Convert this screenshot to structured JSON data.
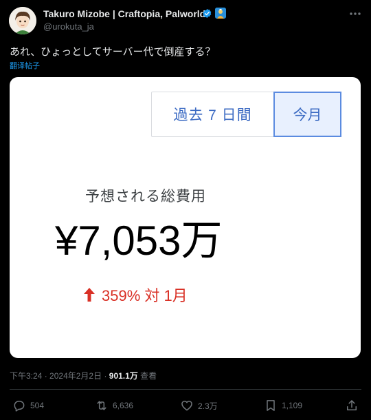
{
  "author": {
    "name": "Takuro Mizobe | Craftopia, Palworld",
    "handle": "@urokuta_ja"
  },
  "tweet": {
    "text": "あれ、ひょっとしてサーバー代で倒産する？",
    "translate_label": "翻译帖子"
  },
  "media": {
    "toggle": {
      "last7_label": "過去 7 日間",
      "month_label": "今月",
      "selected": "今月"
    },
    "cost_label": "予想される総費用",
    "cost_value": "¥7,053万",
    "change_text": "359% 対 1月",
    "colors": {
      "accent_blue": "#3c6bc3",
      "change_red": "#d93025"
    }
  },
  "meta": {
    "time": "下午3:24",
    "separator1": "·",
    "date": "2024年2月2日",
    "separator2": "·",
    "views_count": "901.1万",
    "views_label": "查看"
  },
  "actions": {
    "replies": "504",
    "retweets": "6,636",
    "likes": "2.3万",
    "bookmarks": "1,109"
  },
  "icons": {
    "verified": "verified-badge-icon",
    "affiliate": "affiliate-badge-icon",
    "more": "more-icon",
    "reply": "reply-icon",
    "retweet": "retweet-icon",
    "like": "heart-icon",
    "bookmark": "bookmark-icon",
    "share": "share-icon"
  }
}
